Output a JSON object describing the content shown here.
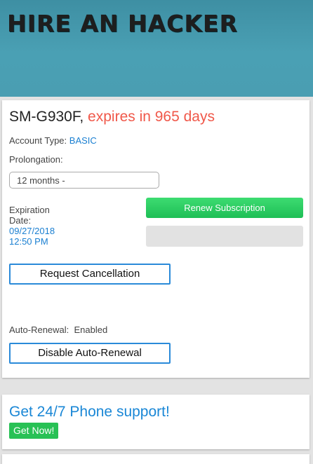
{
  "header": {
    "logo_text": "HIRE AN HACKER"
  },
  "subscription": {
    "device": "SM-G930F,",
    "expires_text": "expires in 965 days",
    "account_type_label": "Account Type:",
    "account_type_value": "BASIC",
    "prolongation_label": "Prolongation:",
    "prolongation_value": "12 months -",
    "expiration_label_1": "Expiration",
    "expiration_label_2": "Date:",
    "expiration_date": "09/27/2018",
    "expiration_time": "12:50 PM",
    "renew_label": "Renew Subscription",
    "cancel_label": "Request Cancellation",
    "auto_renewal_label": "Auto-Renewal:",
    "auto_renewal_value": "Enabled",
    "disable_label": "Disable Auto-Renewal"
  },
  "support": {
    "title": "Get 24/7 Phone support!",
    "cta_label": "Get Now!"
  }
}
